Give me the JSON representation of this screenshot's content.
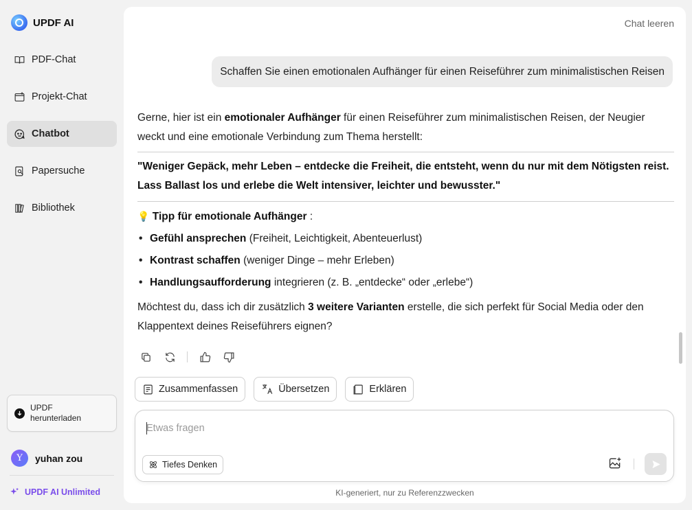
{
  "brand": {
    "name": "UPDF AI"
  },
  "sidebar": {
    "items": [
      {
        "label": "PDF-Chat",
        "icon": "book-open-icon"
      },
      {
        "label": "Projekt-Chat",
        "icon": "folder-plus-icon"
      },
      {
        "label": "Chatbot",
        "icon": "chatbot-icon",
        "active": true
      },
      {
        "label": "Papersuche",
        "icon": "paper-search-icon"
      },
      {
        "label": "Bibliothek",
        "icon": "library-icon"
      }
    ],
    "download_label": "UPDF herunterladen",
    "user": {
      "initial": "Y",
      "name": "yuhan zou"
    },
    "unlimited_label": "UPDF AI Unlimited"
  },
  "header": {
    "clear_chat": "Chat leeren"
  },
  "conversation": {
    "user_message": "Schaffen Sie einen emotionalen Aufhänger für einen Reiseführer zum minimalistischen Reisen",
    "answer": {
      "intro_pre": "Gerne, hier ist ein ",
      "intro_bold": "emotionaler Aufhänger",
      "intro_post": " für einen Reiseführer zum minimalistischen Reisen, der Neugier weckt und eine emotionale Verbindung zum Thema herstellt:",
      "quote": "\"Weniger Gepäck, mehr Leben – entdecke die Freiheit, die entsteht, wenn du nur mit dem Nötigsten reist. Lass Ballast los und erlebe die Welt intensiver, leichter und bewusster.\"",
      "tip_emoji": "💡",
      "tip_bold": "Tipp für emotionale Aufhänger",
      "tip_post": " :",
      "bullets": [
        {
          "bold": "Gefühl ansprechen",
          "text": " (Freiheit, Leichtigkeit, Abenteuerlust)"
        },
        {
          "bold": "Kontrast schaffen",
          "text": " (weniger Dinge – mehr Erleben)"
        },
        {
          "bold": "Handlungsaufforderung",
          "text": " integrieren (z. B. „entdecke“ oder „erlebe“)"
        }
      ],
      "ask_pre": "Möchtest du, dass ich dir zusätzlich ",
      "ask_bold": "3 weitere Varianten",
      "ask_post": " erstelle, die sich perfekt für Social Media oder den Klappentext deines Reiseführers eignen?"
    }
  },
  "quick_actions": {
    "summarize": "Zusammenfassen",
    "translate": "Übersetzen",
    "explain": "Erklären"
  },
  "composer": {
    "placeholder": "Etwas fragen",
    "deep_think": "Tiefes Denken"
  },
  "footer": {
    "disclaimer": "KI-generiert, nur zu Referenzzwecken"
  },
  "colors": {
    "accent_purple": "#7a4dea",
    "active_nav": "#e0e0e0",
    "background": "#f2f2f2"
  }
}
